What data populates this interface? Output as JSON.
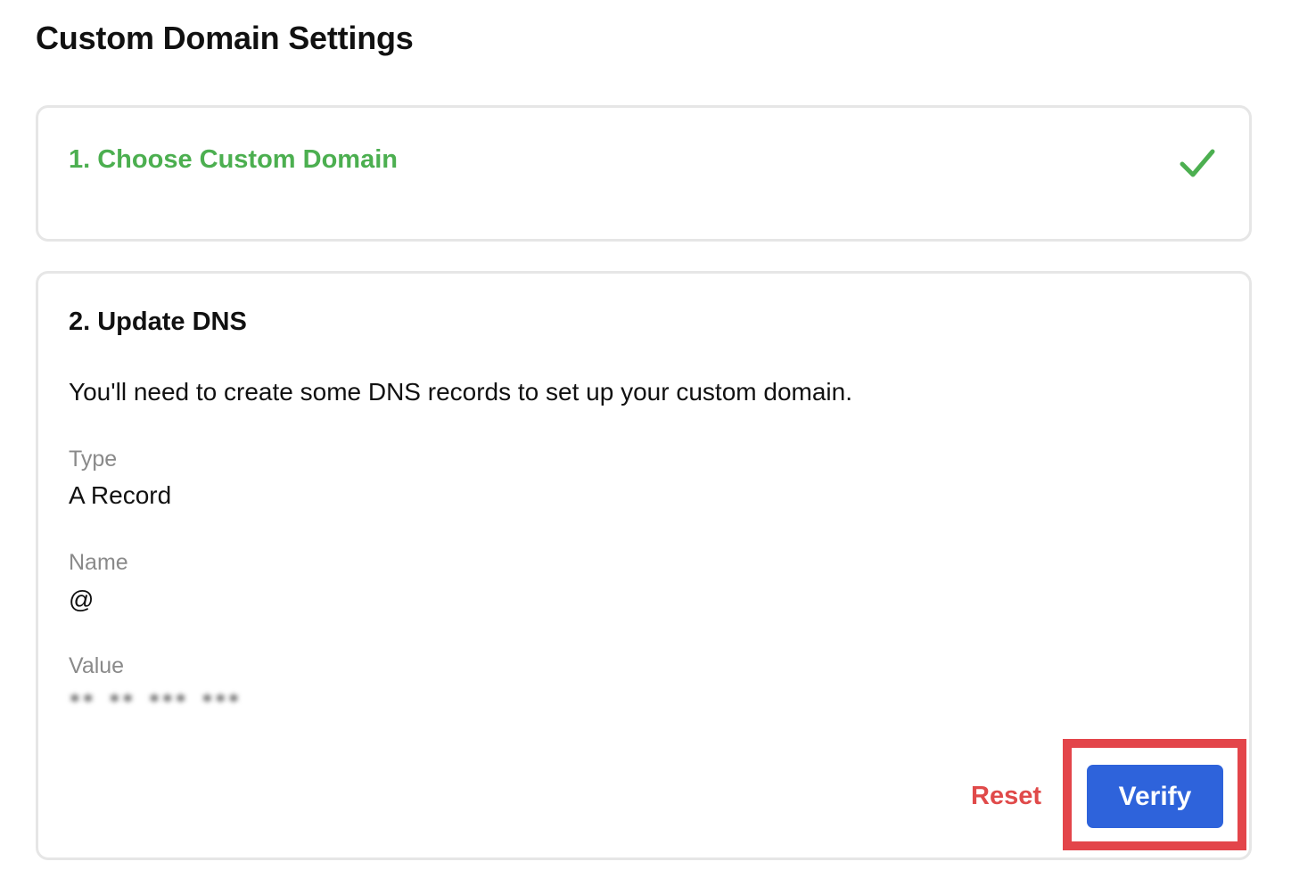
{
  "page": {
    "title": "Custom Domain Settings"
  },
  "steps": [
    {
      "title": "1. Choose Custom Domain",
      "status": "completed",
      "status_icon": "check-icon",
      "status_color": "#4caf50"
    },
    {
      "title": "2. Update DNS",
      "description": "You'll need to create some DNS records to set up your custom domain.",
      "fields": [
        {
          "label": "Type",
          "value": "A Record"
        },
        {
          "label": "Name",
          "value": "@"
        },
        {
          "label": "Value",
          "value": "** ** *** ***"
        }
      ],
      "actions": {
        "reset_label": "Reset",
        "verify_label": "Verify"
      }
    }
  ],
  "colors": {
    "success": "#4caf50",
    "danger": "#e04a4a",
    "primary": "#2e63db",
    "highlight": "#e3454a"
  }
}
